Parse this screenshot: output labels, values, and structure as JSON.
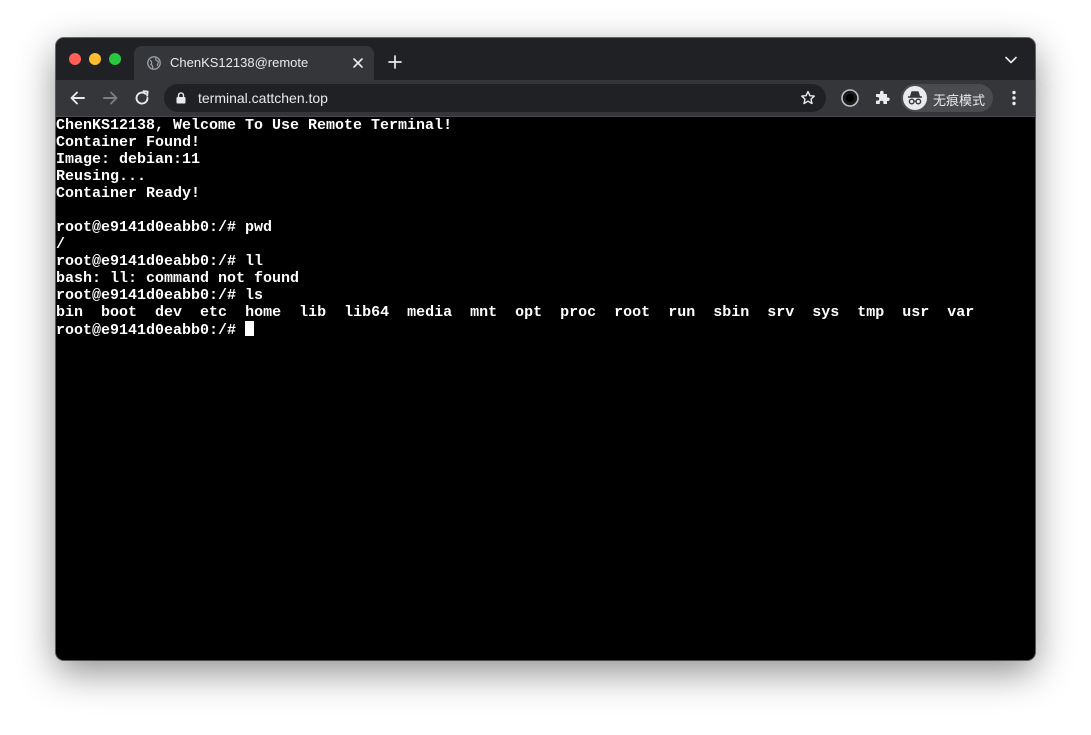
{
  "browser": {
    "tab": {
      "title": "ChenKS12138@remote"
    },
    "url": "terminal.cattchen.top",
    "profile_label": "无痕模式"
  },
  "colors": {
    "tabstrip": "#202124",
    "toolbar": "#35363a",
    "terminal_bg": "#000000",
    "terminal_fg": "#ffffff"
  },
  "terminal": {
    "lines": [
      "ChenKS12138, Welcome To Use Remote Terminal!",
      "Container Found!",
      "Image: debian:11",
      "Reusing...",
      "Container Ready!",
      "",
      "root@e9141d0eabb0:/# pwd",
      "/",
      "root@e9141d0eabb0:/# ll",
      "bash: ll: command not found",
      "root@e9141d0eabb0:/# ls"
    ],
    "ls_output": [
      "bin",
      "boot",
      "dev",
      "etc",
      "home",
      "lib",
      "lib64",
      "media",
      "mnt",
      "opt",
      "proc",
      "root",
      "run",
      "sbin",
      "srv",
      "sys",
      "tmp",
      "usr",
      "var"
    ],
    "prompt": "root@e9141d0eabb0:/# "
  }
}
